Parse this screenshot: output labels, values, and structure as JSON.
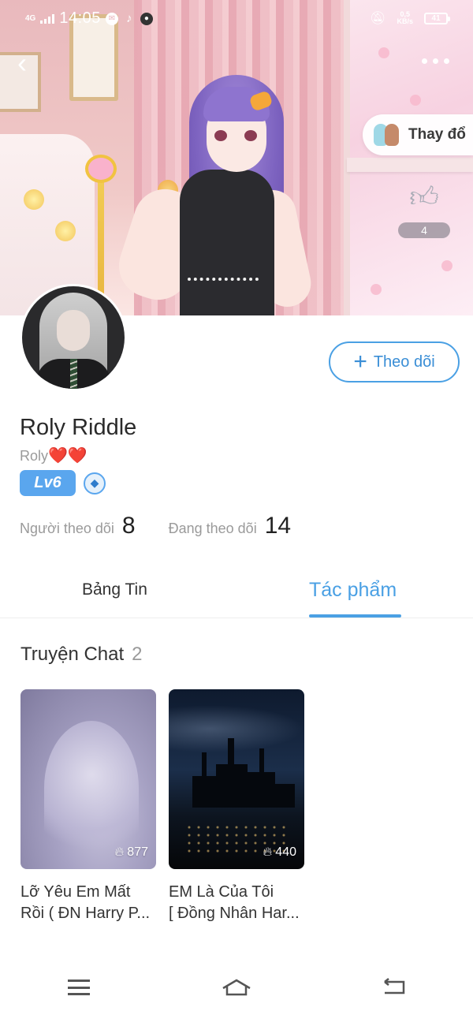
{
  "status_bar": {
    "network": "4G",
    "time": "14:05",
    "speed_value": "0,5",
    "speed_unit": "KB/s",
    "battery": "41"
  },
  "header": {
    "change_label": "Thay đổ",
    "like_count": "4"
  },
  "profile": {
    "name": "Roly Riddle",
    "handle": "Roly",
    "handle_hearts": "❤️❤️",
    "level": "Lv6",
    "follow_label": "Theo dõi",
    "followers_label": "Người theo dõi",
    "followers_value": "8",
    "following_label": "Đang theo dõi",
    "following_value": "14"
  },
  "tabs": [
    {
      "label": "Bảng Tin",
      "active": false
    },
    {
      "label": "Tác phẩm",
      "active": true
    }
  ],
  "section": {
    "title": "Truyện Chat",
    "count": "2"
  },
  "stories": [
    {
      "title": "Lỡ Yêu Em Mất",
      "title_line2": "Rồi ( ĐN Harry P...",
      "views": "877"
    },
    {
      "title": "EM Là Của Tôi",
      "title_line2": "[ Đồng Nhân Har...",
      "views": "440"
    }
  ],
  "icons": {
    "back": "chevron-left-icon",
    "more": "more-dots-icon",
    "like": "thumbs-up-icon",
    "follow": "plus-icon",
    "views": "fire-icon",
    "medal": "shield-medal-icon",
    "nav": [
      "menu-icon",
      "home-icon",
      "back-arrow-icon"
    ]
  },
  "colors": {
    "accent": "#4aa0e4",
    "level_badge": "#5aa6ee",
    "muted_text": "#9a9a9a"
  }
}
